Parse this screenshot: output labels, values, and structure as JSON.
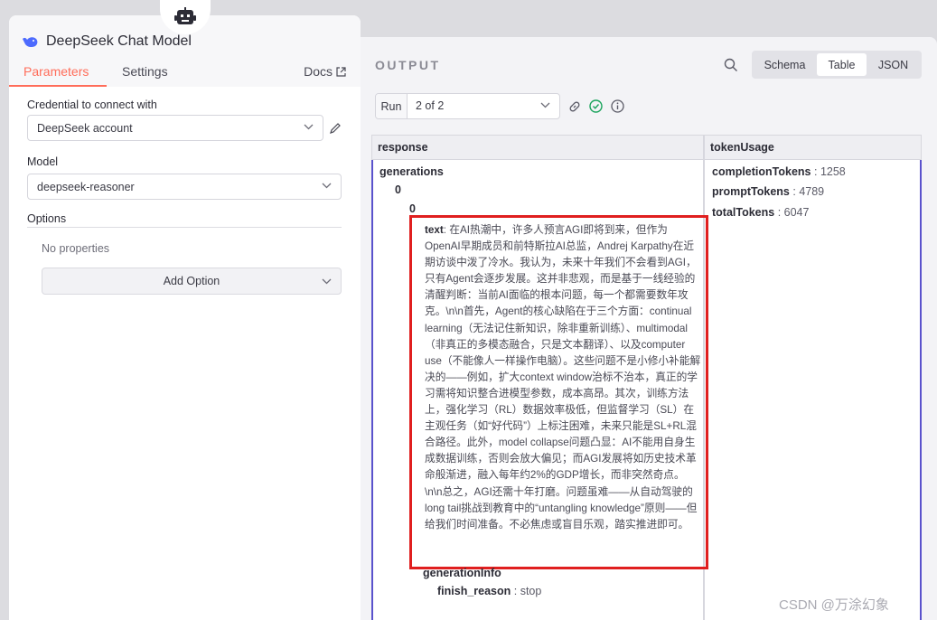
{
  "node": {
    "title": "DeepSeek Chat Model",
    "tabs": [
      "Parameters",
      "Settings"
    ],
    "docs_label": "Docs",
    "credential_label": "Credential to connect with",
    "credential_value": "DeepSeek account",
    "model_label": "Model",
    "model_value": "deepseek-reasoner",
    "options_label": "Options",
    "no_properties": "No properties",
    "add_option": "Add Option",
    "accent_color": "#ff6d5a"
  },
  "output": {
    "title": "OUTPUT",
    "views": [
      "Schema",
      "Table",
      "JSON"
    ],
    "active_view": "Table",
    "run_label": "Run",
    "run_value": "2 of 2",
    "columns": [
      "response",
      "tokenUsage"
    ],
    "response": {
      "generations": "generations",
      "idx0": "0",
      "idx1": "0",
      "text_key": "text",
      "text_value": "在AI热潮中，许多人预言AGI即将到来，但作为OpenAI早期成员和前特斯拉AI总监，Andrej Karpathy在近期访谈中泼了冷水。我认为，未来十年我们不会看到AGI，只有Agent会逐步发展。这并非悲观，而是基于一线经验的清醒判断：当前AI面临的根本问题，每一个都需要数年攻克。\\n\\n首先，Agent的核心缺陷在于三个方面：continual learning（无法记住新知识，除非重新训练）、multimodal（非真正的多模态融合，只是文本翻译）、以及computer use（不能像人一样操作电脑）。这些问题不是小修小补能解决的——例如，扩大context window治标不治本，真正的学习需将知识整合进模型参数，成本高昂。其次，训练方法上，强化学习（RL）数据效率极低，但监督学习（SL）在主观任务（如“好代码”）上标注困难，未来只能是SL+RL混合路径。此外，model collapse问题凸显：AI不能用自身生成数据训练，否则会放大偏见；而AGI发展将如历史技术革命般渐进，融入每年约2%的GDP增长，而非突然奇点。\\n\\n总之，AGI还需十年打磨。问题虽难——从自动驾驶的long tail挑战到教育中的“untangling knowledge”原则——但给我们时间准备。不必焦虑或盲目乐观，踏实推进即可。",
      "generation_info": "generationInfo",
      "finish_reason_key": "finish_reason",
      "finish_reason_value": "stop"
    },
    "token_usage": {
      "completion_key": "completionTokens",
      "completion_value": "1258",
      "prompt_key": "promptTokens",
      "prompt_value": "4789",
      "total_key": "totalTokens",
      "total_value": "6047"
    }
  },
  "watermark": "CSDN @万涂幻象"
}
